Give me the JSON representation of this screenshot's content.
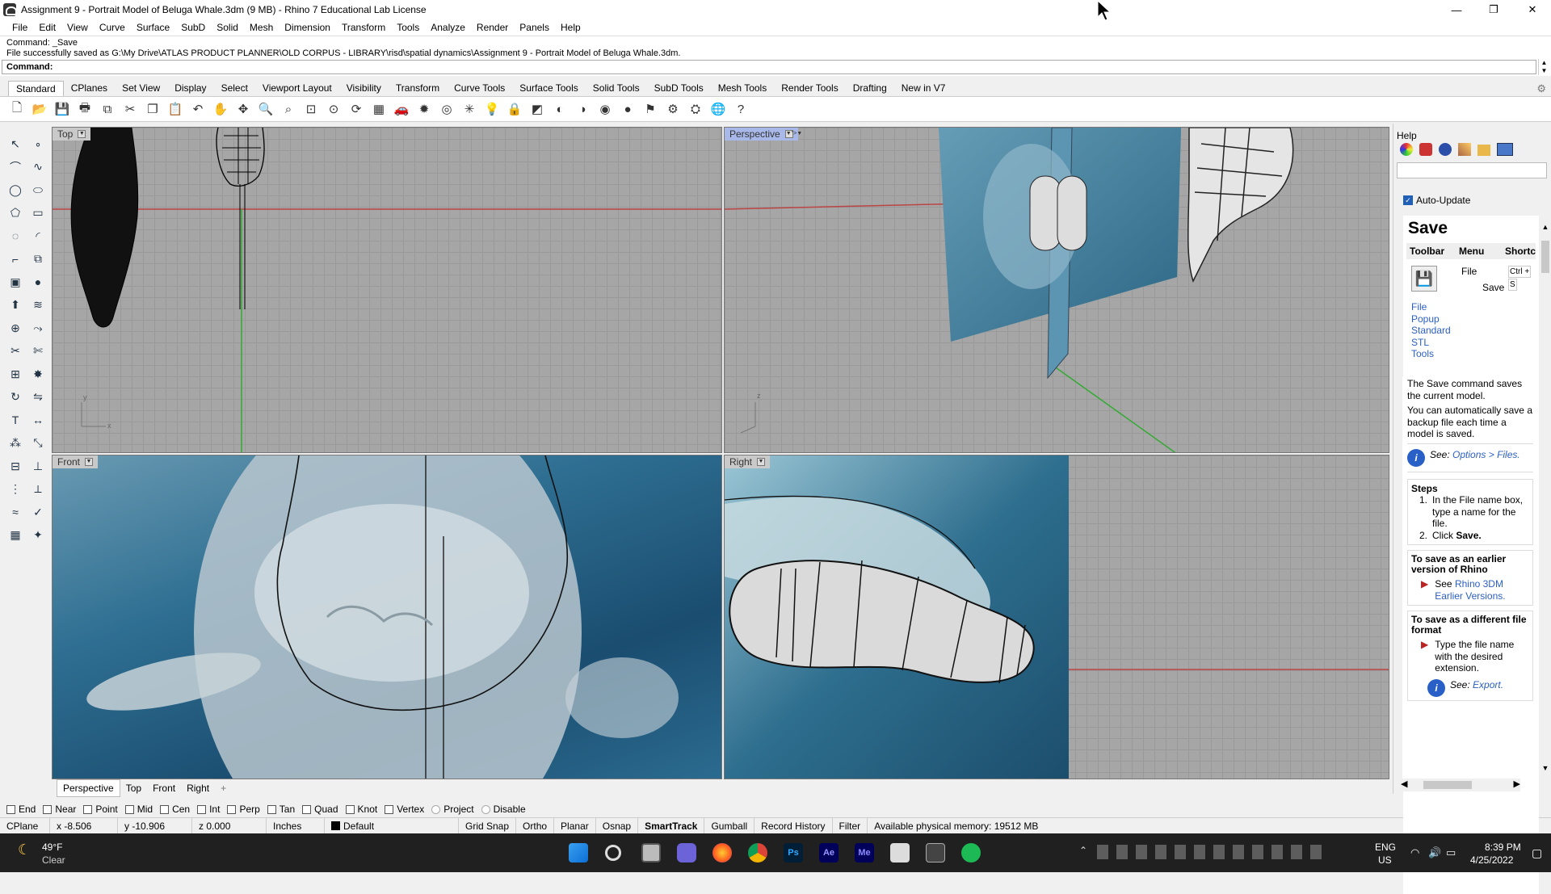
{
  "window": {
    "title": "Assignment 9 - Portrait Model of Beluga Whale.3dm (9 MB) - Rhino 7 Educational Lab License",
    "minimize": "—",
    "maximize": "❐",
    "close": "✕"
  },
  "menu": [
    "File",
    "Edit",
    "View",
    "Curve",
    "Surface",
    "SubD",
    "Solid",
    "Mesh",
    "Dimension",
    "Transform",
    "Tools",
    "Analyze",
    "Render",
    "Panels",
    "Help"
  ],
  "command": {
    "line1": "Command: _Save",
    "line2": "File successfully saved as G:\\My Drive\\ATLAS PRODUCT PLANNER\\OLD CORPUS - LIBRARY\\risd\\spatial dynamics\\Assignment 9 - Portrait Model of Beluga Whale.3dm.",
    "prompt": "Command:"
  },
  "toolbar_tabs": [
    "Standard",
    "CPlanes",
    "Set View",
    "Display",
    "Select",
    "Viewport Layout",
    "Visibility",
    "Transform",
    "Curve Tools",
    "Surface Tools",
    "Solid Tools",
    "SubD Tools",
    "Mesh Tools",
    "Render Tools",
    "Drafting",
    "New in V7"
  ],
  "toolbar_icons": [
    "new-icon",
    "open-icon",
    "save-icon",
    "print-icon",
    "import-icon",
    "cut-icon",
    "copy-icon",
    "paste-icon",
    "undo-icon",
    "pan-icon",
    "move-icon",
    "zoom-icon",
    "zoom-window-icon",
    "zoom-extents-icon",
    "zoom-selected-icon",
    "rotate-view-icon",
    "grid-icon",
    "car-icon",
    "light-icon",
    "target-icon",
    "point-icon",
    "bulb-icon",
    "lock-icon",
    "layer-icon",
    "color-icon",
    "material-icon",
    "render-icon",
    "sphere-icon",
    "highlight-icon",
    "settings-icon",
    "tools-icon",
    "globe-icon",
    "help-icon"
  ],
  "toolbar_glyphs": [
    "🗋",
    "📂",
    "💾",
    "🖶",
    "⧉",
    "✂",
    "❐",
    "📋",
    "↶",
    "✋",
    "✥",
    "🔍",
    "⌕",
    "⊡",
    "⊙",
    "⟳",
    "▦",
    "🚗",
    "✹",
    "◎",
    "✳",
    "💡",
    "🔒",
    "◩",
    "◐",
    "◑",
    "◉",
    "●",
    "⚑",
    "⚙",
    "⛭",
    "🌐",
    "?"
  ],
  "viewports": {
    "top": "Top",
    "perspective": "Perspective",
    "front": "Front",
    "right": "Right"
  },
  "viewport_tabs": [
    "Perspective",
    "Top",
    "Front",
    "Right",
    "+"
  ],
  "osnaps": [
    "End",
    "Near",
    "Point",
    "Mid",
    "Cen",
    "Int",
    "Perp",
    "Tan",
    "Quad",
    "Knot",
    "Vertex",
    "Project",
    "Disable"
  ],
  "status": {
    "cplane": "CPlane",
    "x": "x -8.506",
    "y": "y -10.906",
    "z": "z 0.000",
    "units": "Inches",
    "layer": "Default",
    "items": [
      "Grid Snap",
      "Ortho",
      "Planar",
      "Osnap",
      "SmartTrack",
      "Gumball",
      "Record History",
      "Filter"
    ],
    "memory": "Available physical memory: 19512 MB"
  },
  "help": {
    "panel": "Help",
    "auto_update": "Auto-Update",
    "title": "Save",
    "headers": [
      "Toolbar",
      "Menu",
      "Shortc"
    ],
    "menu_path": [
      "File",
      "Save"
    ],
    "shortcut": [
      "Ctrl +",
      "S"
    ],
    "toolbar_links": [
      "File",
      "Popup",
      "Standard",
      "STL",
      "Tools"
    ],
    "desc1": "The Save command saves the current model.",
    "desc2": "You can automatically save a backup file each time a model is saved.",
    "see": "See:",
    "see_link": "Options > Files.",
    "steps_title": "Steps",
    "step1": "In the File name box, type a name for the file.",
    "step2_prefix": "Click",
    "step2_bold": "Save.",
    "older_title": "To save as an earlier version of Rhino",
    "older_prefix": "See",
    "older_link": "Rhino 3DM Earlier Versions.",
    "diff_title": "To save as a different file format",
    "diff_text": "Type the file name with the desired extension.",
    "diff_see": "See:",
    "diff_link": "Export."
  },
  "taskbar": {
    "temp": "49°F",
    "weather": "Clear",
    "lang1": "ENG",
    "lang2": "US",
    "time": "8:39 PM",
    "date": "4/25/2022"
  }
}
